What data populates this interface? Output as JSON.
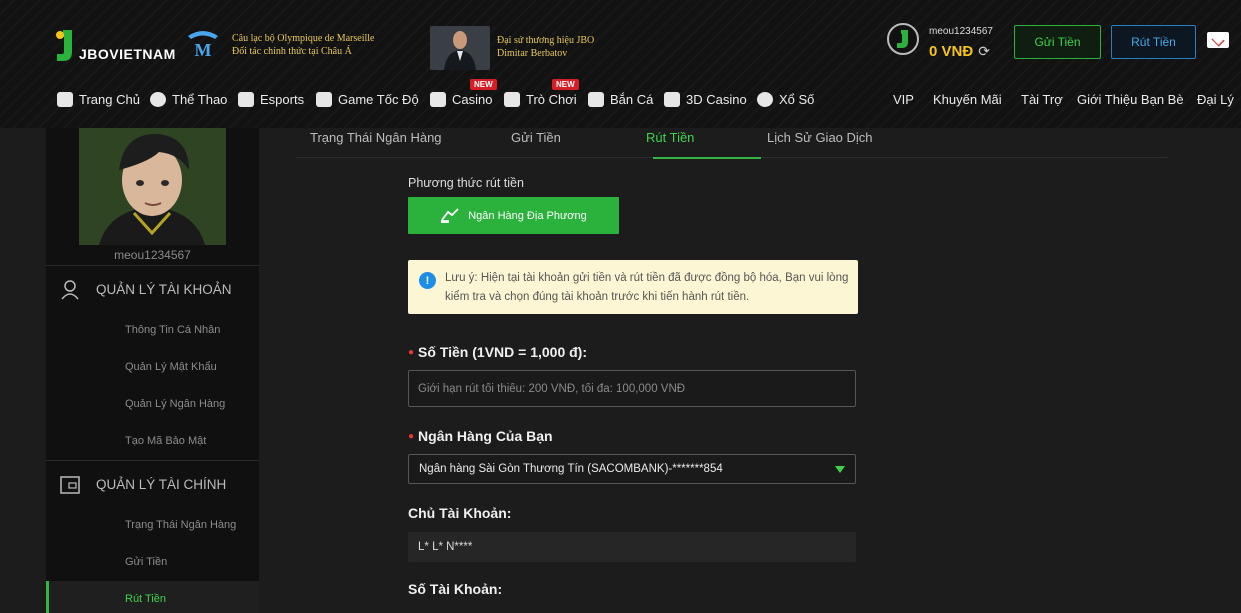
{
  "header": {
    "brand": "JBOVIETNAM",
    "partner_line1": "Câu lạc bộ Olympique de Marseille",
    "partner_line2": "Đối tác chính thức tại Châu Á",
    "ambassador_line1": "Đại sứ thương hiệu JBO",
    "ambassador_line2": "Dimitar Berbatov",
    "username": "meou1234567",
    "balance": "0 VNĐ",
    "deposit_label": "Gửi Tiền",
    "withdraw_label": "Rút Tiền"
  },
  "nav": {
    "items": [
      {
        "label": "Trang Chủ",
        "icon": "home-icon"
      },
      {
        "label": "Thể Thao",
        "icon": "soccer-ball-icon"
      },
      {
        "label": "Esports",
        "icon": "gamepad-icon"
      },
      {
        "label": "Game Tốc Độ",
        "icon": "speed-game-icon"
      },
      {
        "label": "Casino",
        "icon": "cards-icon",
        "badge": "NEW"
      },
      {
        "label": "Trò Chơi",
        "icon": "slot-machine-icon",
        "badge": "NEW"
      },
      {
        "label": "Bắn Cá",
        "icon": "fish-icon"
      },
      {
        "label": "3D Casino",
        "icon": "dice-icon"
      },
      {
        "label": "Xổ Số",
        "icon": "lottery-icon"
      }
    ],
    "right_items": [
      "VIP",
      "Khuyến Mãi",
      "Tài Trợ",
      "Giới Thiệu Bạn Bè",
      "Đại Lý"
    ]
  },
  "sidebar": {
    "username": "meou1234567",
    "account_section": "QUẢN LÝ TÀI KHOẢN",
    "account_links": [
      "Thông Tin Cá Nhân",
      "Quản Lý Mật Khẩu",
      "Quản Lý Ngân Hàng",
      "Tạo Mã Bảo Mật"
    ],
    "finance_section": "QUẢN LÝ TÀI CHÍNH",
    "finance_links": [
      "Trạng Thái Ngân Hàng",
      "Gửi Tiền",
      "Rút Tiền"
    ]
  },
  "tabs": [
    "Trạng Thái Ngân Hàng",
    "Gửi Tiền",
    "Rút Tiền",
    "Lịch Sử Giao Dịch"
  ],
  "form": {
    "method_label": "Phương thức rút tiền",
    "method_button": "Ngân Hàng Địa Phương",
    "notice": "Lưu ý: Hiện tại tài khoản gửi tiền và rút tiền đã được đồng bộ hóa, Bạn vui lòng kiểm tra và chọn đúng tài khoản trước khi tiến hành rút tiền.",
    "amount_label": "Số Tiền (1VND = 1,000 đ):",
    "amount_placeholder": "Giới hạn rút tối thiểu: 200 VNĐ, tối đa: 100,000 VNĐ",
    "bank_label": "Ngân Hàng Của Bạn",
    "bank_value": "Ngân hàng Sài Gòn Thương Tín (SACOMBANK)-*******854",
    "holder_label": "Chủ Tài Khoản:",
    "holder_value": "L* L* N****",
    "account_no_label": "Số Tài Khoản:"
  },
  "colors": {
    "accent_green": "#2ab23c",
    "gold": "#f5c518",
    "blue": "#2a7fc0",
    "badge_red": "#d51e26"
  }
}
